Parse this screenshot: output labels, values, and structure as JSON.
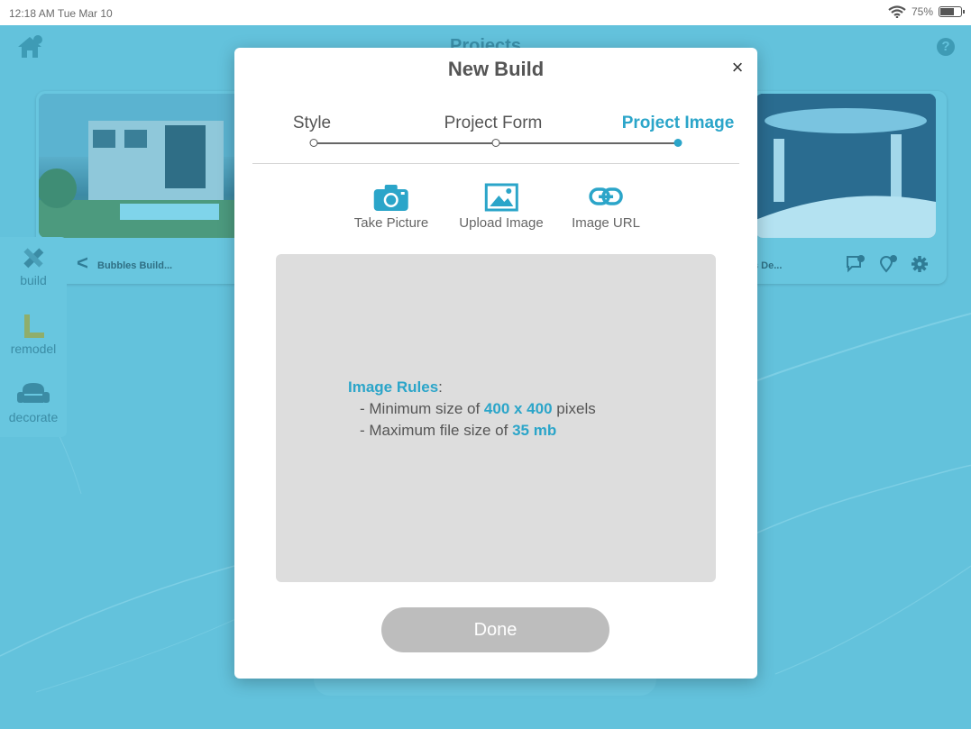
{
  "status_bar": {
    "time": "12:18 AM  Tue Mar 10",
    "battery": "75%",
    "battery_level": 0.75
  },
  "app": {
    "title": "Projects",
    "home_badge": "10",
    "help": "?",
    "card": {
      "left_caption": "Bubbles Build...",
      "right_caption": "s De...",
      "back": "<",
      "chat_badge": "1",
      "pin_badge": "10"
    },
    "side_menu": [
      {
        "label": "build"
      },
      {
        "label": "remodel"
      },
      {
        "label": "decorate"
      }
    ]
  },
  "modal": {
    "title": "New Build",
    "close": "×",
    "steps": [
      {
        "label": "Style",
        "active": false
      },
      {
        "label": "Project Form",
        "active": false
      },
      {
        "label": "Project Image",
        "active": true
      }
    ],
    "sources": [
      {
        "label": "Take Picture",
        "icon": "camera-icon"
      },
      {
        "label": "Upload Image",
        "icon": "image-icon"
      },
      {
        "label": "Image URL",
        "icon": "link-icon"
      }
    ],
    "rules": {
      "heading": "Image Rules",
      "heading_suffix": ":",
      "line1_prefix": "- Minimum size of ",
      "line1_value": "400 x 400",
      "line1_suffix": " pixels",
      "line2_prefix": "- Maximum file size of ",
      "line2_value": "35 mb"
    },
    "done_label": "Done"
  },
  "colors": {
    "accent": "#2ba5c9",
    "background": "#63c2dc",
    "done_disabled": "#bdbdbd"
  }
}
